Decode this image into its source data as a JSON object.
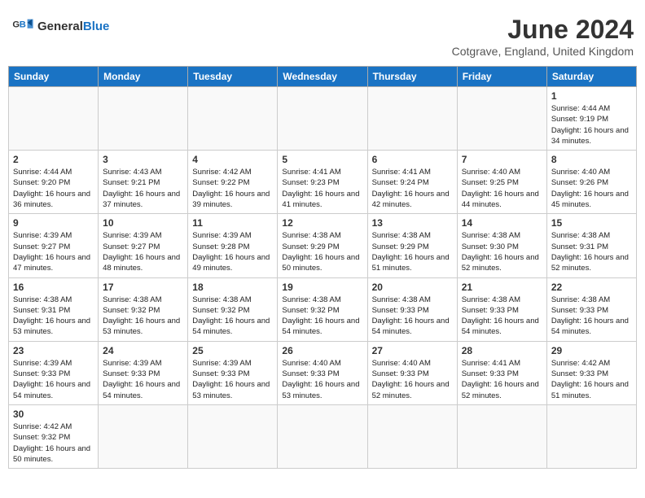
{
  "header": {
    "logo_general": "General",
    "logo_blue": "Blue",
    "month_title": "June 2024",
    "subtitle": "Cotgrave, England, United Kingdom"
  },
  "days": [
    "Sunday",
    "Monday",
    "Tuesday",
    "Wednesday",
    "Thursday",
    "Friday",
    "Saturday"
  ],
  "weeks": [
    [
      {
        "date": "",
        "info": ""
      },
      {
        "date": "",
        "info": ""
      },
      {
        "date": "",
        "info": ""
      },
      {
        "date": "",
        "info": ""
      },
      {
        "date": "",
        "info": ""
      },
      {
        "date": "",
        "info": ""
      },
      {
        "date": "1",
        "info": "Sunrise: 4:44 AM\nSunset: 9:19 PM\nDaylight: 16 hours and 34 minutes."
      }
    ],
    [
      {
        "date": "2",
        "info": "Sunrise: 4:44 AM\nSunset: 9:20 PM\nDaylight: 16 hours and 36 minutes."
      },
      {
        "date": "3",
        "info": "Sunrise: 4:43 AM\nSunset: 9:21 PM\nDaylight: 16 hours and 37 minutes."
      },
      {
        "date": "4",
        "info": "Sunrise: 4:42 AM\nSunset: 9:22 PM\nDaylight: 16 hours and 39 minutes."
      },
      {
        "date": "5",
        "info": "Sunrise: 4:41 AM\nSunset: 9:23 PM\nDaylight: 16 hours and 41 minutes."
      },
      {
        "date": "6",
        "info": "Sunrise: 4:41 AM\nSunset: 9:24 PM\nDaylight: 16 hours and 42 minutes."
      },
      {
        "date": "7",
        "info": "Sunrise: 4:40 AM\nSunset: 9:25 PM\nDaylight: 16 hours and 44 minutes."
      },
      {
        "date": "8",
        "info": "Sunrise: 4:40 AM\nSunset: 9:26 PM\nDaylight: 16 hours and 45 minutes."
      }
    ],
    [
      {
        "date": "9",
        "info": "Sunrise: 4:39 AM\nSunset: 9:27 PM\nDaylight: 16 hours and 47 minutes."
      },
      {
        "date": "10",
        "info": "Sunrise: 4:39 AM\nSunset: 9:27 PM\nDaylight: 16 hours and 48 minutes."
      },
      {
        "date": "11",
        "info": "Sunrise: 4:39 AM\nSunset: 9:28 PM\nDaylight: 16 hours and 49 minutes."
      },
      {
        "date": "12",
        "info": "Sunrise: 4:38 AM\nSunset: 9:29 PM\nDaylight: 16 hours and 50 minutes."
      },
      {
        "date": "13",
        "info": "Sunrise: 4:38 AM\nSunset: 9:29 PM\nDaylight: 16 hours and 51 minutes."
      },
      {
        "date": "14",
        "info": "Sunrise: 4:38 AM\nSunset: 9:30 PM\nDaylight: 16 hours and 52 minutes."
      },
      {
        "date": "15",
        "info": "Sunrise: 4:38 AM\nSunset: 9:31 PM\nDaylight: 16 hours and 52 minutes."
      }
    ],
    [
      {
        "date": "16",
        "info": "Sunrise: 4:38 AM\nSunset: 9:31 PM\nDaylight: 16 hours and 53 minutes."
      },
      {
        "date": "17",
        "info": "Sunrise: 4:38 AM\nSunset: 9:32 PM\nDaylight: 16 hours and 53 minutes."
      },
      {
        "date": "18",
        "info": "Sunrise: 4:38 AM\nSunset: 9:32 PM\nDaylight: 16 hours and 54 minutes."
      },
      {
        "date": "19",
        "info": "Sunrise: 4:38 AM\nSunset: 9:32 PM\nDaylight: 16 hours and 54 minutes."
      },
      {
        "date": "20",
        "info": "Sunrise: 4:38 AM\nSunset: 9:33 PM\nDaylight: 16 hours and 54 minutes."
      },
      {
        "date": "21",
        "info": "Sunrise: 4:38 AM\nSunset: 9:33 PM\nDaylight: 16 hours and 54 minutes."
      },
      {
        "date": "22",
        "info": "Sunrise: 4:38 AM\nSunset: 9:33 PM\nDaylight: 16 hours and 54 minutes."
      }
    ],
    [
      {
        "date": "23",
        "info": "Sunrise: 4:39 AM\nSunset: 9:33 PM\nDaylight: 16 hours and 54 minutes."
      },
      {
        "date": "24",
        "info": "Sunrise: 4:39 AM\nSunset: 9:33 PM\nDaylight: 16 hours and 54 minutes."
      },
      {
        "date": "25",
        "info": "Sunrise: 4:39 AM\nSunset: 9:33 PM\nDaylight: 16 hours and 53 minutes."
      },
      {
        "date": "26",
        "info": "Sunrise: 4:40 AM\nSunset: 9:33 PM\nDaylight: 16 hours and 53 minutes."
      },
      {
        "date": "27",
        "info": "Sunrise: 4:40 AM\nSunset: 9:33 PM\nDaylight: 16 hours and 52 minutes."
      },
      {
        "date": "28",
        "info": "Sunrise: 4:41 AM\nSunset: 9:33 PM\nDaylight: 16 hours and 52 minutes."
      },
      {
        "date": "29",
        "info": "Sunrise: 4:42 AM\nSunset: 9:33 PM\nDaylight: 16 hours and 51 minutes."
      }
    ],
    [
      {
        "date": "30",
        "info": "Sunrise: 4:42 AM\nSunset: 9:32 PM\nDaylight: 16 hours and 50 minutes."
      },
      {
        "date": "",
        "info": ""
      },
      {
        "date": "",
        "info": ""
      },
      {
        "date": "",
        "info": ""
      },
      {
        "date": "",
        "info": ""
      },
      {
        "date": "",
        "info": ""
      },
      {
        "date": "",
        "info": ""
      }
    ]
  ]
}
